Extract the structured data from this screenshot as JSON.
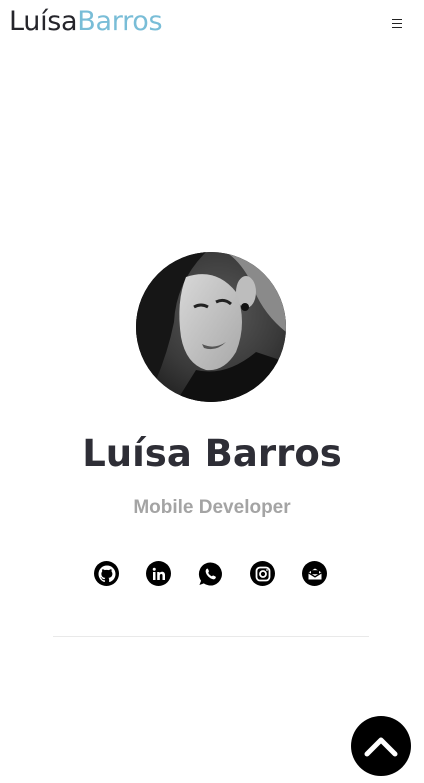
{
  "header": {
    "brand_first": "Luísa",
    "brand_last": "Barros",
    "brand_first_color": "#25252b",
    "brand_last_color": "#79bdd7",
    "menu_icon": "hamburger-menu-icon"
  },
  "profile": {
    "name": "Luísa Barros",
    "role": "Mobile Developer",
    "avatar_icon": "profile-photo"
  },
  "socials": [
    {
      "name": "github",
      "icon": "github-icon"
    },
    {
      "name": "linkedin",
      "icon": "linkedin-icon"
    },
    {
      "name": "whatsapp",
      "icon": "whatsapp-icon"
    },
    {
      "name": "instagram",
      "icon": "instagram-icon"
    },
    {
      "name": "email",
      "icon": "envelope-icon"
    }
  ],
  "scroll_top": {
    "icon": "chevron-up-icon"
  },
  "colors": {
    "accent": "#79bdd7",
    "text": "#2e2e36",
    "muted": "#a4a4a4",
    "icon": "#000000"
  }
}
